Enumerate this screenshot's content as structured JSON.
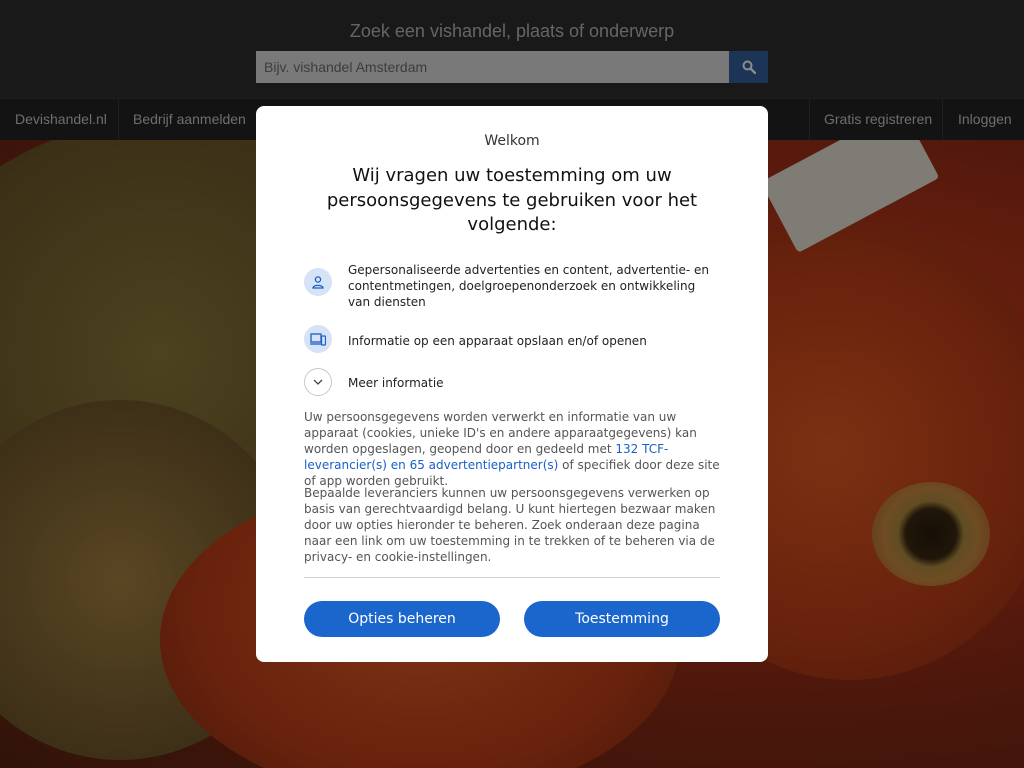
{
  "header": {
    "title": "Zoek een vishandel, plaats of onderwerp",
    "search_placeholder": "Bijv. vishandel Amsterdam",
    "search_icon": "search-icon"
  },
  "nav": {
    "left": [
      "Devishandel.nl",
      "Bedrijf aanmelden"
    ],
    "right": [
      "Gratis registreren",
      "Inloggen"
    ]
  },
  "consent": {
    "welcome": "Welkom",
    "heading": "Wij vragen uw toestemming om uw persoonsgegevens te gebruiken voor het volgende:",
    "purposes": [
      {
        "icon": "person-icon",
        "text": "Gepersonaliseerde advertenties en content, advertentie- en contentmetingen, doelgroepenonderzoek en ontwikkeling van diensten"
      },
      {
        "icon": "devices-icon",
        "text": "Informatie op een apparaat opslaan en/of openen"
      }
    ],
    "more_info": "Meer informatie",
    "para1_before": "Uw persoonsgegevens worden verwerkt en informatie van uw apparaat (cookies, unieke ID's en andere apparaatgegevens) kan worden opgeslagen, geopend door en gedeeld met ",
    "para1_link": "132 TCF-leverancier(s) en 65 advertentiepartner(s)",
    "para1_after": " of specifiek door deze site of app worden gebruikt.",
    "para2": "Bepaalde leveranciers kunnen uw persoonsgegevens verwerken op basis van gerechtvaardigd belang. U kunt hiertegen bezwaar maken door uw opties hieronder te beheren. Zoek onderaan deze pagina naar een link om uw toestemming in te trekken of te beheren via de privacy- en cookie-instellingen.",
    "manage_button": "Opties beheren",
    "consent_button": "Toestemming"
  },
  "colors": {
    "accent": "#1a66cc",
    "icon_bg": "#d6e2f5",
    "search_button": "#34609c"
  }
}
